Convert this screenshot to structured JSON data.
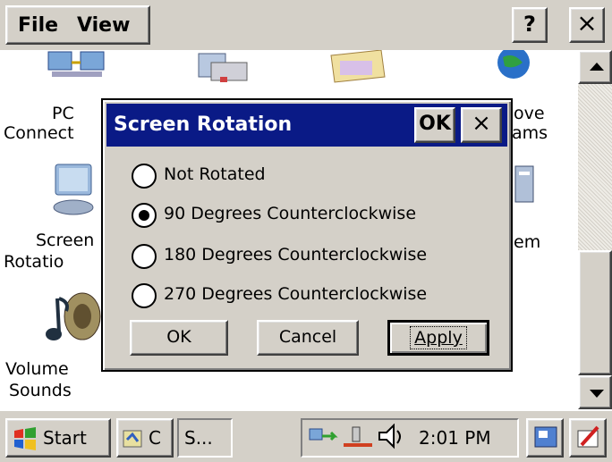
{
  "menu": {
    "file": "File",
    "view": "View",
    "help": "?",
    "close": "×"
  },
  "desktop": {
    "icons": [
      {
        "label1": "PC",
        "label2": "Connect"
      },
      {
        "label1": "Screen",
        "label2": "Rotatio"
      },
      {
        "label1": "Volume",
        "label2": "Sounds"
      },
      {
        "label1": "ove",
        "label2": "ams"
      },
      {
        "label1": "em",
        "label2": ""
      }
    ]
  },
  "dialog": {
    "title": "Screen Rotation",
    "ok_title": "OK",
    "close_title": "×",
    "options": [
      {
        "label": "Not Rotated",
        "checked": false
      },
      {
        "label": "90 Degrees Counterclockwise",
        "checked": true
      },
      {
        "label": "180 Degrees Counterclockwise",
        "checked": false
      },
      {
        "label": "270 Degrees Counterclockwise",
        "checked": false
      }
    ],
    "ok_button": "OK",
    "cancel_button": "Cancel",
    "apply_button": "Apply"
  },
  "taskbar": {
    "start": "Start",
    "task1": "C",
    "task2": "S...",
    "clock": "2:01 PM"
  },
  "colors": {
    "titlebar": "#0a1a86",
    "face": "#d4d0c8"
  }
}
